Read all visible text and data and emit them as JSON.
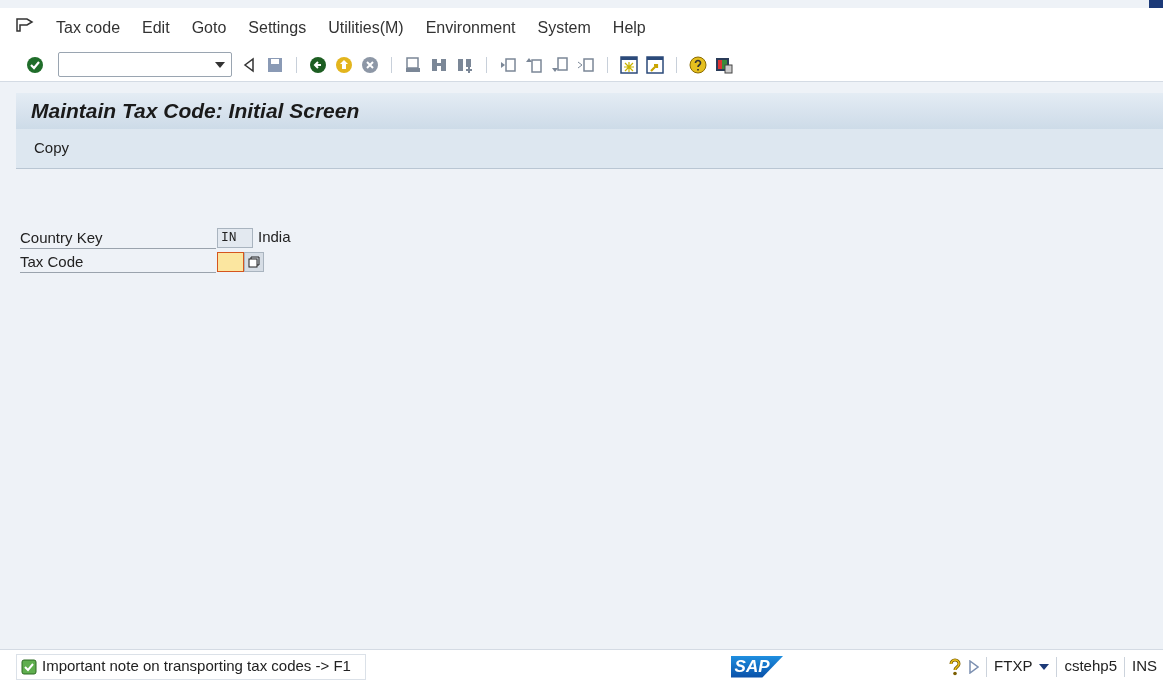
{
  "menu": [
    {
      "label": "Tax code"
    },
    {
      "label": "Edit"
    },
    {
      "label": "Goto"
    },
    {
      "label": "Settings"
    },
    {
      "label": "Utilities(M)"
    },
    {
      "label": "Environment"
    },
    {
      "label": "System"
    },
    {
      "label": "Help"
    }
  ],
  "title": "Maintain Tax Code: Initial Screen",
  "app_toolbar": [
    "Copy"
  ],
  "fields": [
    {
      "label": "Country Key",
      "value": "IN",
      "description": "India",
      "focused": false
    },
    {
      "label": "Tax Code",
      "focused": true
    }
  ],
  "status_bar": {
    "message": "Important note on transporting tax codes -> F1",
    "logo": "SAP",
    "transaction": "FTXP",
    "server": "cstehp5",
    "mode": "INS"
  }
}
